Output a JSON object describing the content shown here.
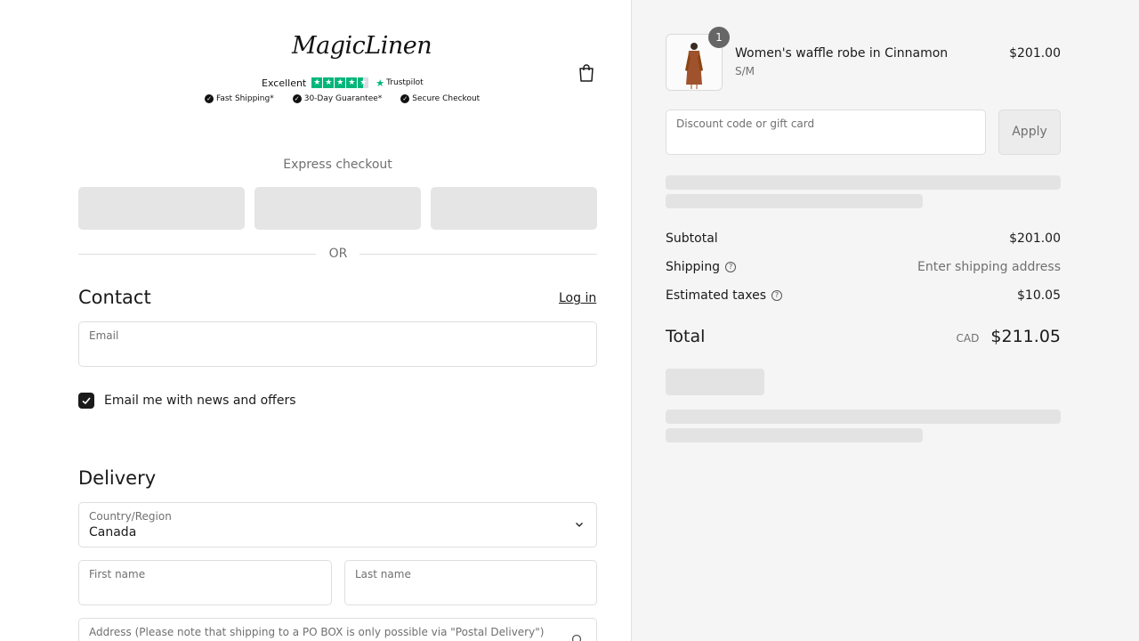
{
  "header": {
    "logo_text": "MagicLinen",
    "trust_label": "Excellent",
    "trust_brand": "Trustpilot",
    "badges": [
      "Fast Shipping*",
      "30-Day Guarantee*",
      "Secure Checkout"
    ]
  },
  "express": {
    "title": "Express checkout",
    "divider": "OR"
  },
  "contact": {
    "title": "Contact",
    "login_link": "Log in",
    "email_label": "Email",
    "email_value": "",
    "newsletter_label": "Email me with news and offers",
    "newsletter_checked": true
  },
  "delivery": {
    "title": "Delivery",
    "country_label": "Country/Region",
    "country_value": "Canada",
    "first_name_label": "First name",
    "last_name_label": "Last name",
    "address_label": "Address (Please note that shipping to a PO BOX is only possible via \"Postal Delivery\")"
  },
  "order": {
    "item": {
      "quantity": "1",
      "name": "Women's waffle robe in Cinnamon",
      "variant": "S/M",
      "price": "$201.00"
    },
    "discount_label": "Discount code or gift card",
    "apply_label": "Apply",
    "subtotal_label": "Subtotal",
    "subtotal_value": "$201.00",
    "shipping_label": "Shipping",
    "shipping_value": "Enter shipping address",
    "taxes_label": "Estimated taxes",
    "taxes_value": "$10.05",
    "total_label": "Total",
    "total_currency": "CAD",
    "total_value": "$211.05"
  },
  "colors": {
    "trustpilot_green": "#00b67a",
    "checkbox": "#1a1a1a",
    "sidebar_bg": "#f5f5f5",
    "skeleton": "#e3e3e3"
  }
}
